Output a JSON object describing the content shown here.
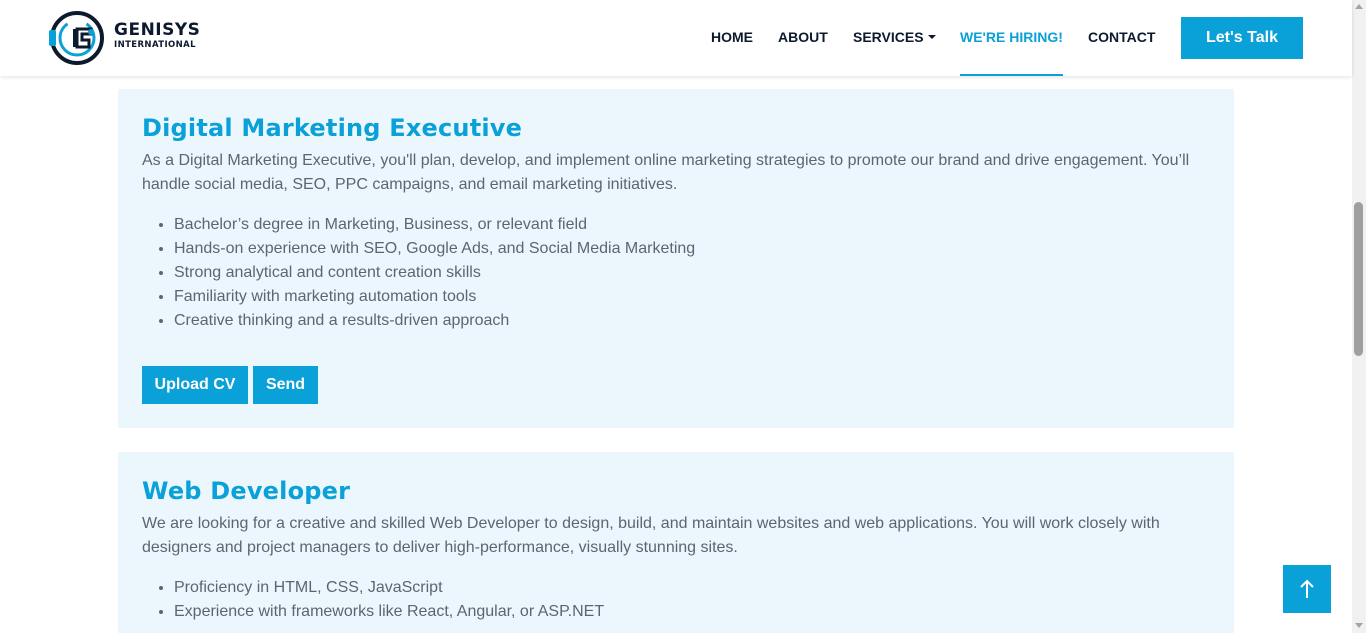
{
  "brand": {
    "name": "GENISYS",
    "subtitle": "INTERNATIONAL",
    "accent_color": "#0aa0d8",
    "dark_color": "#0d1a2e"
  },
  "nav": {
    "items": [
      {
        "label": "HOME"
      },
      {
        "label": "ABOUT"
      },
      {
        "label": "SERVICES"
      },
      {
        "label": "WE'RE HIRING!"
      },
      {
        "label": "CONTACT"
      }
    ],
    "active": "WE'RE HIRING!",
    "cta_label": "Let's Talk"
  },
  "jobs": [
    {
      "title": "Digital Marketing Executive",
      "description": "As a Digital Marketing Executive, you'll plan, develop, and implement online marketing strategies to promote our brand and drive engagement. You’ll handle social media, SEO, PPC campaigns, and email marketing initiatives.",
      "requirements": [
        "Bachelor’s degree in Marketing, Business, or relevant field",
        "Hands-on experience with SEO, Google Ads, and Social Media Marketing",
        "Strong analytical and content creation skills",
        "Familiarity with marketing automation tools",
        "Creative thinking and a results-driven approach"
      ],
      "upload_label": "Upload CV",
      "send_label": "Send"
    },
    {
      "title": "Web Developer",
      "description": "We are looking for a creative and skilled Web Developer to design, build, and maintain websites and web applications. You will work closely with designers and project managers to deliver high-performance, visually stunning sites.",
      "requirements": [
        "Proficiency in HTML, CSS, JavaScript",
        "Experience with frameworks like React, Angular, or ASP.NET"
      ]
    }
  ],
  "icons": {
    "back_to_top": "arrow-up-icon",
    "services_dropdown": "caret-down-icon"
  }
}
